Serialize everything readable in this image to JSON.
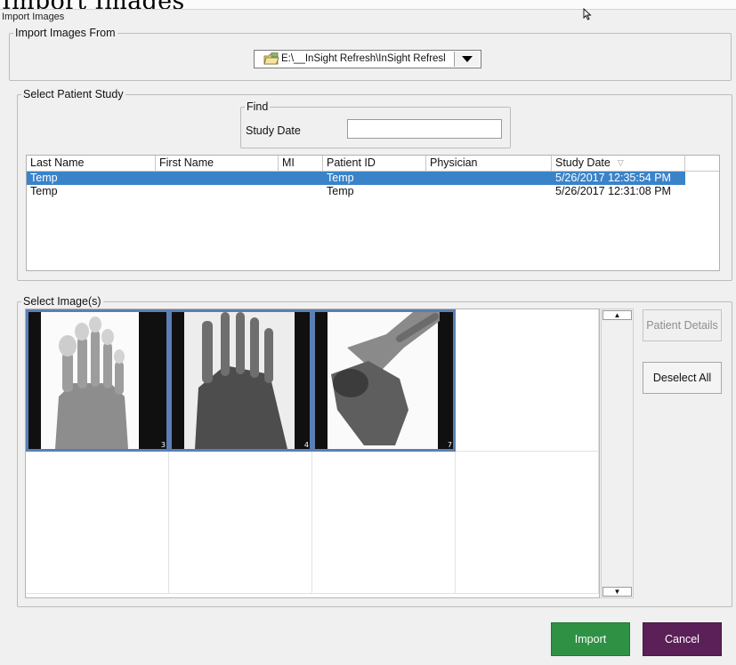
{
  "window": {
    "title": "Import Images",
    "title_bar_text": "Import Images"
  },
  "import_from": {
    "label": "Import Images From",
    "path": "E:\\__InSight Refresh\\InSight Refresl",
    "folder_icon": "folder-icon",
    "dropdown_icon": "chevron-down-icon"
  },
  "patient_study": {
    "label": "Select Patient Study",
    "find": {
      "label": "Find",
      "study_date_label": "Study Date",
      "study_date_value": ""
    },
    "columns": [
      "Last Name",
      "First Name",
      "MI",
      "Patient ID",
      "Physician",
      "Study Date"
    ],
    "sort_column": "Study Date",
    "sort_icon": "sort-descending-icon",
    "rows": [
      {
        "last_name": "Temp",
        "first_name": "",
        "mi": "",
        "patient_id": "Temp",
        "physician": "",
        "study_date": "5/26/2017 12:35:54 PM",
        "selected": true
      },
      {
        "last_name": "Temp",
        "first_name": "",
        "mi": "",
        "patient_id": "Temp",
        "physician": "",
        "study_date": "5/26/2017 12:31:08 PM",
        "selected": false
      }
    ],
    "selection_color": "#3a83c9"
  },
  "images": {
    "label": "Select Image(s)",
    "thumbnails": [
      {
        "number": "3",
        "subject": "foot x-ray AP view",
        "selected": true
      },
      {
        "number": "4",
        "subject": "foot x-ray oblique view",
        "selected": true
      },
      {
        "number": "7",
        "subject": "foot x-ray lateral view",
        "selected": true
      }
    ],
    "scroll_up_icon": "scroll-up-arrow-icon",
    "scroll_down_icon": "scroll-down-arrow-icon"
  },
  "buttons": {
    "patient_details": "Patient Details",
    "deselect_all": "Deselect All",
    "import": "Import",
    "cancel": "Cancel"
  },
  "colors": {
    "import_button": "#2e9143",
    "cancel_button": "#5c2058",
    "thumbnail_selected_border": "#5b7fb5"
  }
}
